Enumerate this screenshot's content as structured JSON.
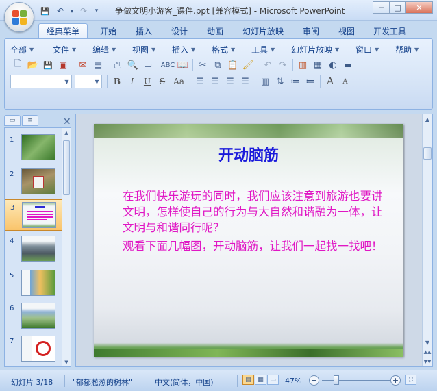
{
  "window": {
    "title": "争做文明小游客_课件.ppt [兼容模式] - Microsoft PowerPoint",
    "minimize": "─",
    "maximize": "□",
    "close": "✕"
  },
  "qat": {
    "save": "💾",
    "undo": "↶",
    "redo": "↷",
    "customize": "▾"
  },
  "ribbon_tabs": [
    "经典菜单",
    "开始",
    "插入",
    "设计",
    "动画",
    "幻灯片放映",
    "审阅",
    "视图",
    "开发工具"
  ],
  "active_tab": "经典菜单",
  "menu": [
    "全部",
    "文件",
    "编辑",
    "视图",
    "插入",
    "格式",
    "工具",
    "幻灯片放映",
    "窗口",
    "帮助"
  ],
  "format": {
    "bold": "B",
    "italic": "I",
    "underline": "U",
    "strike": "S",
    "change_case": "Aa",
    "grow_font": "A",
    "shrink_font": "A"
  },
  "slides_panel": {
    "thumbnails": [
      {
        "number": "1",
        "style": "green-forest"
      },
      {
        "number": "2",
        "style": "photo-sign"
      },
      {
        "number": "3",
        "style": "text-slide",
        "selected": true
      },
      {
        "number": "4",
        "style": "photo-people"
      },
      {
        "number": "5",
        "style": "photo-kids"
      },
      {
        "number": "6",
        "style": "photo-field"
      },
      {
        "number": "7",
        "style": "no-sign"
      }
    ]
  },
  "slide": {
    "title": "开动脑筋",
    "paragraphs": [
      "在我们快乐游玩的同时，我们应该注意到旅游也要讲文明，怎样使自己的行为与大自然和谐融为一体，让文明与和谐同行呢？",
      "观看下面几幅图，开动脑筋，让我们一起找一找吧！"
    ],
    "title_color": "#1a1adb",
    "body_color": "#e017c4"
  },
  "statusbar": {
    "slide_indicator": "幻灯片 3/18",
    "theme": "\"郁郁葱葱的树林\"",
    "language": "中文(简体，中国)",
    "zoom": "47%",
    "zoom_level": 0.47,
    "zoom_out": "−",
    "zoom_in": "+"
  },
  "colors": {
    "accent": "#15428b",
    "ribbon_bg": "#c4d9f0"
  }
}
